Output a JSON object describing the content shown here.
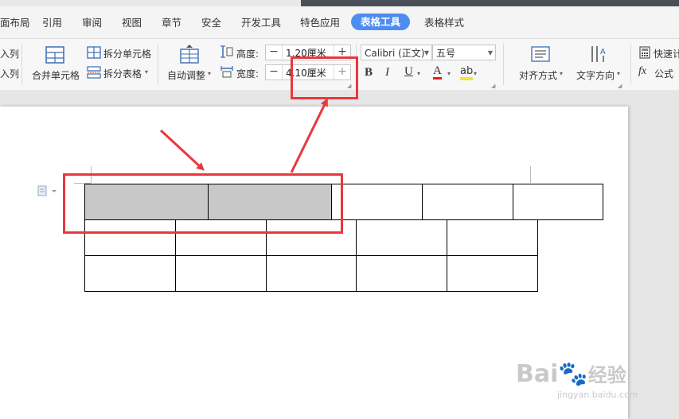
{
  "tabs": [
    {
      "label": "面布局"
    },
    {
      "label": "引用"
    },
    {
      "label": "审阅"
    },
    {
      "label": "视图"
    },
    {
      "label": "章节"
    },
    {
      "label": "安全"
    },
    {
      "label": "开发工具"
    },
    {
      "label": "特色应用"
    },
    {
      "label": "表格工具",
      "active": true
    },
    {
      "label": "表格样式"
    }
  ],
  "ribbon": {
    "insert_col_1": "入列",
    "insert_col_2": "入列",
    "merge_cells": "合并单元格",
    "split_cells": "拆分单元格",
    "split_table": "拆分表格",
    "auto_fit": "自动调整",
    "height_label": "高度:",
    "height_value": "1.20厘米",
    "width_label": "宽度:",
    "width_value": "4.10厘米",
    "font_name": "Calibri (正文)",
    "font_size": "五号",
    "bold": "B",
    "italic": "I",
    "underline": "U",
    "font_color": "A",
    "highlight": "ab",
    "align": "对齐方式",
    "text_direction": "文字方向",
    "quick_calc": "快速计",
    "formula_fx": "fx",
    "formula": "公式"
  },
  "colors": {
    "accent": "#4e8df0",
    "annotation_red": "#e8383d",
    "selected_cell": "#c8c8c8"
  },
  "watermark": {
    "brand": "Bai",
    "brand2": "经验",
    "url": "jingyan.baidu.com"
  }
}
